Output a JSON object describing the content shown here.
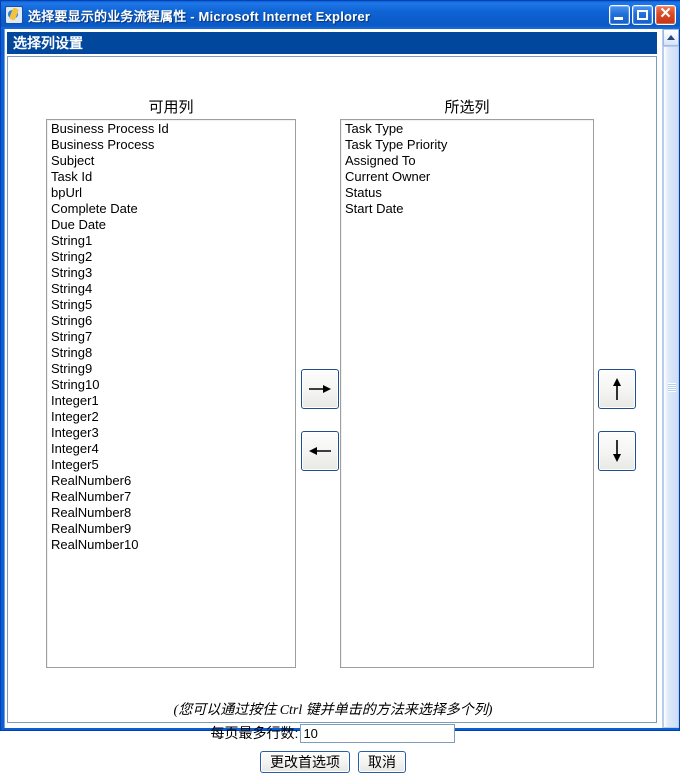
{
  "window": {
    "title": "选择要显示的业务流程属性 - Microsoft Internet Explorer",
    "icon": "ie-document-icon",
    "minimize_label": "最小化",
    "maximize_label": "最大化",
    "close_label": "关闭"
  },
  "page": {
    "header": "选择列设置",
    "header_color": "#00479d"
  },
  "columns": {
    "available_caption": "可用列",
    "selected_caption": "所选列",
    "available_items": [
      "Business Process Id",
      "Business Process",
      "Subject",
      "Task Id",
      "bpUrl",
      "Complete Date",
      "Due Date",
      "String1",
      "String2",
      "String3",
      "String4",
      "String5",
      "String6",
      "String7",
      "String8",
      "String9",
      "String10",
      "Integer1",
      "Integer2",
      "Integer3",
      "Integer4",
      "Integer5",
      "RealNumber6",
      "RealNumber7",
      "RealNumber8",
      "RealNumber9",
      "RealNumber10"
    ],
    "selected_items": [
      "Task Type",
      "Task Type Priority",
      "Assigned To",
      "Current Owner",
      "Status",
      "Start Date"
    ]
  },
  "transfer_buttons": {
    "add_icon": "arrow-right-icon",
    "remove_icon": "arrow-left-icon",
    "move_up_icon": "arrow-up-icon",
    "move_down_icon": "arrow-down-icon"
  },
  "hint": "(您可以通过按住 Ctrl 键并单击的方法来选择多个列)",
  "rows_per_page": {
    "label": "每页最多行数:",
    "value": "10"
  },
  "buttons": {
    "submit": "更改首选项",
    "cancel": "取消"
  },
  "scrollbar": {
    "up_arrow": "▲",
    "down_arrow": "▼"
  }
}
